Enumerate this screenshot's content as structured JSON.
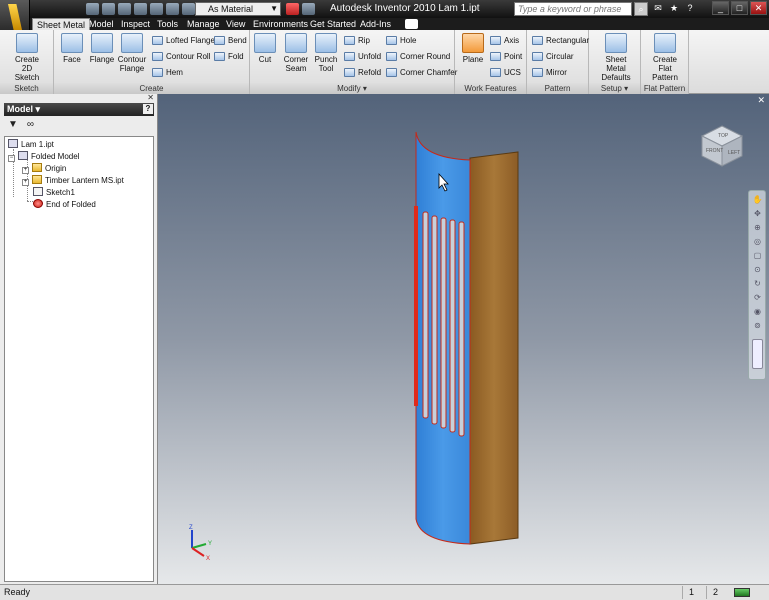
{
  "titlebar": {
    "app_title": "Autodesk Inventor 2010   Lam 1.ipt",
    "material": "As Material",
    "search_placeholder": "Type a keyword or phrase"
  },
  "tabs": [
    "Sheet Metal",
    "Model",
    "Inspect",
    "Tools",
    "Manage",
    "View",
    "Environments",
    "Get Started",
    "Add-Ins"
  ],
  "ribbon": {
    "sketch": {
      "label": "Sketch",
      "create_sketch": "Create 2D Sketch"
    },
    "create": {
      "label": "Create",
      "face": "Face",
      "flange": "Flange",
      "contour_flange": "Contour Flange",
      "lofted_flange": "Lofted Flange",
      "contour_roll": "Contour Roll",
      "hem": "Hem",
      "bend": "Bend",
      "fold": "Fold"
    },
    "modify": {
      "label": "Modify",
      "cut": "Cut",
      "corner_seam": "Corner Seam",
      "punch_tool": "Punch Tool",
      "rip": "Rip",
      "unfold": "Unfold",
      "refold": "Refold",
      "hole": "Hole",
      "corner_round": "Corner Round",
      "corner_chamfer": "Corner Chamfer"
    },
    "work_features": {
      "label": "Work Features",
      "plane": "Plane",
      "axis": "Axis",
      "point": "Point",
      "ucs": "UCS"
    },
    "pattern": {
      "label": "Pattern",
      "rectangular": "Rectangular",
      "circular": "Circular",
      "mirror": "Mirror"
    },
    "setup": {
      "label": "Setup",
      "sheet_metal_defaults": "Sheet Metal Defaults"
    },
    "flat_pattern": {
      "label": "Flat Pattern",
      "create_flat_pattern": "Create Flat Pattern"
    }
  },
  "browser": {
    "title": "Model",
    "tree": [
      "Lam 1.ipt",
      "Folded Model",
      "Origin",
      "Timber Lantern MS.ipt",
      "Sketch1",
      "End of Folded"
    ]
  },
  "viewcube": {
    "front": "FRONT",
    "left": "LEFT",
    "top": "TOP"
  },
  "triad": {
    "x": "X",
    "y": "Y",
    "z": "Z"
  },
  "colors": {
    "face_blue": "#3d8fe0",
    "wood": "#9a6a2c",
    "slot_red": "#e02a1a"
  },
  "status": {
    "text": "Ready",
    "n1": "1",
    "n2": "2"
  }
}
